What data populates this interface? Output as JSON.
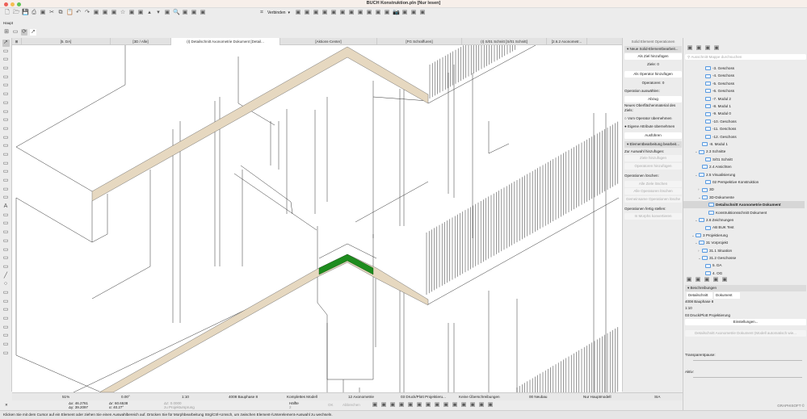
{
  "window": {
    "title": "BUCH Konstruktion.pln [Nur lesen]"
  },
  "toolbar": {
    "connect_label": "Verbinden",
    "icons_top": [
      "new-icon",
      "open-icon",
      "save-icon",
      "print-icon",
      "project-icon",
      "cut-icon",
      "copy-icon",
      "paste-icon",
      "undo-icon",
      "redo-icon",
      "layer-icon",
      "grid-icon",
      "magic-wand-icon",
      "favorite-icon",
      "eyedropper-icon",
      "syringe-icon",
      "arrow-up-icon",
      "arrow-down-icon",
      "trim-icon",
      "zoom-icon",
      "align-icon",
      "distribute-icon",
      "corner-icon"
    ],
    "icons_right": [
      "solid-ops-icon",
      "group-icon",
      "lock-icon",
      "layers-icon",
      "floor-plan-icon",
      "section-icon",
      "elevation-icon",
      "3d-window-icon",
      "view-map-icon",
      "navigator-icon",
      "render-icon",
      "camera-icon",
      "layout-icon",
      "publish-icon",
      "teamwork-icon"
    ],
    "haupt_label": "Haupt"
  },
  "tabs": [
    {
      "label": "[5. DA]"
    },
    {
      "label": "[3D / Alle]"
    },
    {
      "label": "(I) Detailschnitt Axonometrie Dokument [Detail..."
    },
    {
      "label": "[Aktions-Center]"
    },
    {
      "label": "[FG Schraffuren]"
    },
    {
      "label": "(I) S/01 Schnitt [S/01 Schnitt]"
    },
    {
      "label": "[2.6.2 Axonometr..."
    }
  ],
  "toolbox": [
    "arrow-icon",
    "marquee-icon",
    "wall-icon",
    "column-icon",
    "beam-icon",
    "slab-icon",
    "roof-icon",
    "shell-icon",
    "mesh-icon",
    "morph-icon",
    "railing-icon",
    "stair-icon",
    "curtain-wall-icon",
    "door-icon",
    "window-icon",
    "skylight-icon",
    "object-icon",
    "lamp-icon",
    "zone-icon",
    "text-icon",
    "label-icon",
    "dimension-icon",
    "level-dimension-icon",
    "radial-dimension-icon",
    "angle-dimension-icon",
    "spot-icon",
    "fill-icon",
    "line-icon",
    "circle-icon",
    "polyline-icon",
    "spline-icon",
    "hotspot-icon",
    "figure-icon",
    "section-marker-icon",
    "detail-icon",
    "elevation-marker-icon",
    "worksheet-icon"
  ],
  "solid_ops": {
    "title": "Solid Element Operationen",
    "section1": "Neue Solid-Elementbearbeit...",
    "add_target": "Als Ziel hinzufügen",
    "targets": "Ziele: 0",
    "add_operator": "Als Operator hinzufügen",
    "operators": "Operatoren: 0",
    "choose_operation": "Operation auswählen:",
    "operation": "Abzug",
    "new_material": "Neues Oberflächenmaterial des Ziels:",
    "radio1": "Vom Operator übernehmen",
    "radio2": "Eigene Attribute übernehmen",
    "radio_selected": "Eigene Attribute übernehmen",
    "execute": "Ausführen",
    "section2": "Elementbearbeitung bearbeit...",
    "add_to_selection": "Zur Auswahl hinzufügen:",
    "add_targets": "Ziele hinzufügen",
    "add_operators": "Operatoren hinzufügen",
    "delete_ops": "Operationen löschen:",
    "delete_targets": "Alle Ziele löschen",
    "delete_operators": "Alle Operatoren löschen",
    "delete_common": "Gemeinsame Operationen lösche",
    "finish_ops": "Operationen fertig stellen:",
    "convert": "In Morphs konvertieren"
  },
  "navigator": {
    "search_placeholder": "Ausschnitt-Mappe durchsuchen",
    "tree": [
      {
        "label": "-3. Geschoss",
        "lvl": 5
      },
      {
        "label": "-4. Geschoss",
        "lvl": 5
      },
      {
        "label": "-5. Geschoss",
        "lvl": 5
      },
      {
        "label": "-6. Geschoss",
        "lvl": 5
      },
      {
        "label": "-7. Modul 2",
        "lvl": 5
      },
      {
        "label": "-8. Modul 1",
        "lvl": 5
      },
      {
        "label": "-9. Modul 0",
        "lvl": 5
      },
      {
        "label": "-10. Geschoss",
        "lvl": 5
      },
      {
        "label": "-11. Geschoss",
        "lvl": 5
      },
      {
        "label": "-12. Geschoss",
        "lvl": 5
      },
      {
        "label": "-8. Modul 1",
        "lvl": 4
      },
      {
        "label": "2.3 Schnitte",
        "lvl": 3,
        "exp": "v"
      },
      {
        "label": "S/01 Schnitt",
        "lvl": 5
      },
      {
        "label": "2.4 Ansichten",
        "lvl": 4
      },
      {
        "label": "2.5 Visualisierung",
        "lvl": 3,
        "exp": "v"
      },
      {
        "label": "02 Perspektive Konstruktion",
        "lvl": 5
      },
      {
        "label": "3D",
        "lvl": 4,
        "exp": ">"
      },
      {
        "label": "3D-Dokumente",
        "lvl": 4,
        "exp": "v"
      },
      {
        "label": "Detailschnitt Axonometrie Dokument",
        "lvl": 6,
        "sel": true
      },
      {
        "label": "Konstruktionsschnitt Dokument",
        "lvl": 6
      },
      {
        "label": "2.6 Zeichnungen",
        "lvl": 3,
        "exp": "v"
      },
      {
        "label": "AB BUK Test",
        "lvl": 5
      },
      {
        "label": "3 Projektierung",
        "lvl": 2,
        "exp": "v"
      },
      {
        "label": "31 Vorprojekt",
        "lvl": 3,
        "exp": "v"
      },
      {
        "label": "31.1 Situation",
        "lvl": 4,
        "exp": ">"
      },
      {
        "label": "31.2 Geschosse",
        "lvl": 4,
        "exp": "v"
      },
      {
        "label": "5. DA",
        "lvl": 5
      },
      {
        "label": "4. OG",
        "lvl": 5
      }
    ],
    "desc_header": "Beschreibungen",
    "id_value": "Detailschnitt",
    "name_value": "Dokument",
    "phase": "4008 Bauphase 8",
    "scale": "1:10",
    "pen_set": "03 Druck/Plott Projektierung",
    "settings": "Einstellungen...",
    "preview": "Detailschnitt Axonometrie Dokument (Modell automatisch wie...",
    "trace_label": "Transparentpause:",
    "active_label": "Aktiv:",
    "brand": "GRAPHISOFT ©"
  },
  "quick_options": {
    "zoom": "51%",
    "angle": "0.00°",
    "scale": "1:10",
    "phase": "4008 Bauphase 8",
    "model_view": "Komplettes Modell",
    "layer_combo": "12 Axonometrie",
    "pen_set": "03 Druck/Plott Projektieru...",
    "override": "Keine Überschreibungen",
    "renovation": "00 Neubau",
    "structure": "Nur Hauptmodell",
    "dim": "SIA"
  },
  "coords": {
    "dx": "Δx: 46.2761",
    "dy": "Δy: 39.2097",
    "dr": "Δr: 60.6538",
    "alpha": "α: 40.27°",
    "dz": "Δz: 0.0000",
    "origin": "zu Projektursprung",
    "split": "Hälfte",
    "split_n": "2",
    "ok": "OK",
    "cancel": "Abbrechen"
  },
  "status": "Klicken Sie mit dem Cursor auf ein Element oder ziehen Sie einen Auswahlbereich auf. Drücken Sie für Morphbearbeitung Strg/Ctrl+Umsch, um zwischen Element-/Unterelement-Auswahl zu wechseln.",
  "colors": {
    "slab_cut": "#e6d8c0",
    "selected_element": "#1e8c1e",
    "accent": "#3b82d6"
  }
}
